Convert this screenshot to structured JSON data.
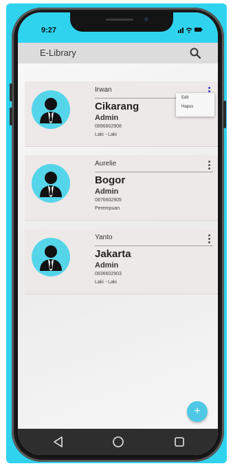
{
  "status_bar": {
    "time": "9:27",
    "icons": [
      "signal-icon",
      "wifi-icon",
      "battery-icon"
    ]
  },
  "app_bar": {
    "title": "E-Library",
    "search_icon": "search-icon"
  },
  "members": [
    {
      "name": "Irwan",
      "city": "Cikarang",
      "role": "Admin",
      "phone": "0896602908",
      "gender": "Laki - Laki",
      "more_color": "#3b3bd6"
    },
    {
      "name": "Aurelie",
      "city": "Bogor",
      "role": "Admin",
      "phone": "0876602905",
      "gender": "Perempuan",
      "more_color": "#555555"
    },
    {
      "name": "Yanto",
      "city": "Jakarta",
      "role": "Admin",
      "phone": "0836602903",
      "gender": "Laki - Laki",
      "more_color": "#555555"
    }
  ],
  "popup_menu": {
    "items": [
      "Edit",
      "Hapus"
    ]
  },
  "fab": {
    "icon": "plus-icon",
    "symbol": "+"
  },
  "nav_bar": {
    "buttons": [
      "back-triangle-icon",
      "home-circle-icon",
      "recents-square-icon"
    ]
  },
  "colors": {
    "frame": "#2fd3ee",
    "avatar_bg": "#55d5ea",
    "fab": "#4fc8e6",
    "card": "#ede9e8"
  }
}
